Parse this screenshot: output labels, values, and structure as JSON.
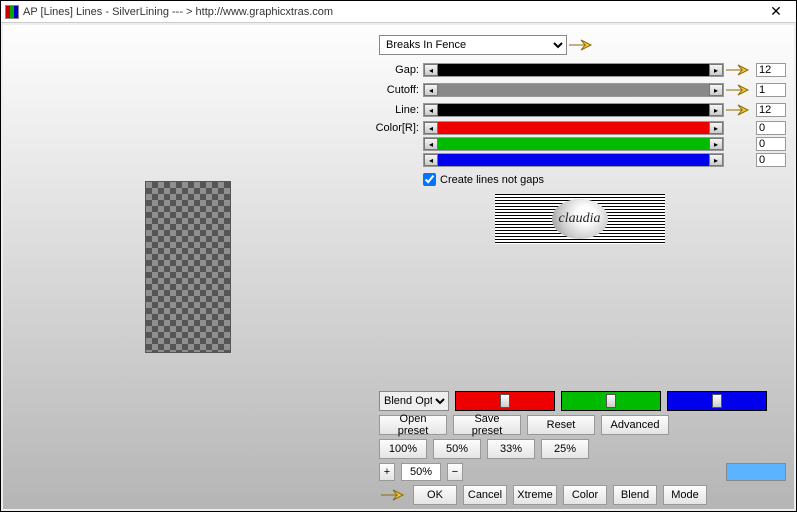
{
  "title": "AP [Lines]  Lines - SilverLining    --- >  http://www.graphicxtras.com",
  "preset_selected": "Breaks In Fence",
  "sliders": {
    "gap": {
      "label": "Gap:",
      "value": "12"
    },
    "cutoff": {
      "label": "Cutoff:",
      "value": "1"
    },
    "line": {
      "label": "Line:",
      "value": "12"
    },
    "colorR": {
      "label": "Color[R]:",
      "value": "0"
    },
    "colorG": {
      "label": "",
      "value": "0"
    },
    "colorB": {
      "label": "",
      "value": "0"
    }
  },
  "checkbox_label": "Create lines not gaps",
  "logo_text": "claudia",
  "blend_label": "Blend Options",
  "buttons": {
    "open_preset": "Open preset",
    "save_preset": "Save preset",
    "reset": "Reset",
    "advanced": "Advanced",
    "p100": "100%",
    "p50": "50%",
    "p33": "33%",
    "p25": "25%",
    "zoom_val": "50%",
    "ok": "OK",
    "cancel": "Cancel",
    "xtreme": "Xtreme",
    "color": "Color",
    "blend": "Blend",
    "mode": "Mode"
  }
}
